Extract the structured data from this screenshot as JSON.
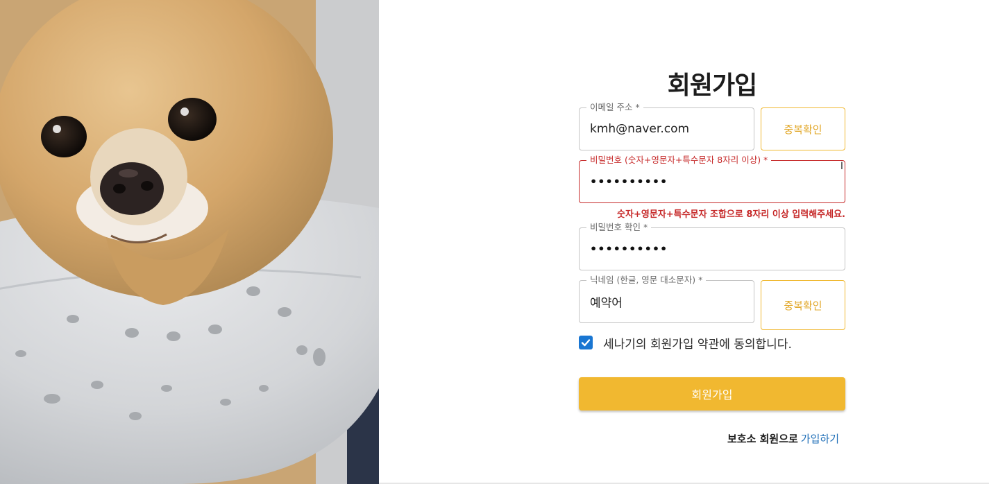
{
  "signup": {
    "title": "회원가입",
    "email": {
      "label": "이메일 주소 *",
      "value": "kmh@naver.com"
    },
    "email_check_button": "중복확인",
    "password": {
      "label": "비밀번호 (숫자+영문자+특수문자 8자리 이상) *",
      "value": "••••••••••",
      "error": "숫자+영문자+특수문자 조합으로 8자리 이상 입력해주세요."
    },
    "password_confirm": {
      "label": "비밀번호 확인 *",
      "value": "••••••••••"
    },
    "nickname": {
      "label": "닉네임 (한글, 영문 대소문자) *",
      "value": "예약어"
    },
    "nickname_check_button": "중복확인",
    "agree": {
      "checked": true,
      "label": "세나기의 회원가입 약관에 동의합니다."
    },
    "submit_button": "회원가입",
    "footer": {
      "text": "보호소 회원으로",
      "link": "가입하기"
    }
  },
  "colors": {
    "accent": "#f1b830",
    "error": "#c62828",
    "checkbox": "#1976d2",
    "link": "#1f6fb8"
  }
}
